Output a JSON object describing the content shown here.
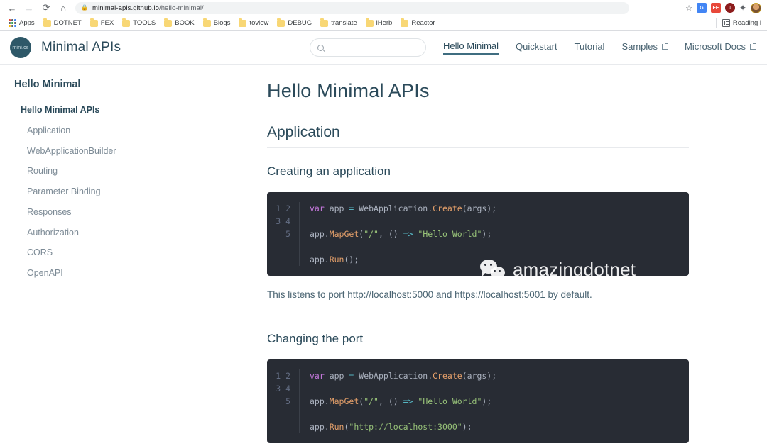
{
  "browser": {
    "back_icon": "←",
    "forward_icon": "→",
    "reload_icon": "⟳",
    "home_icon": "⌂",
    "lock_icon": "🔒",
    "url_domain": "minimal-apis.github.io",
    "url_path": "/hello-minimal/",
    "star_icon": "☆",
    "puzzle_icon": "🧩",
    "extensions": [
      {
        "name": "google-translate-extension",
        "label": "G"
      },
      {
        "name": "fe-extension",
        "label": "FE"
      },
      {
        "name": "ublock-extension",
        "label": "u"
      }
    ],
    "bookmarks": [
      {
        "label": "Apps",
        "icon": "apps-grid-icon"
      },
      {
        "label": "DOTNET",
        "icon": "folder-icon"
      },
      {
        "label": "FEX",
        "icon": "folder-icon"
      },
      {
        "label": "TOOLS",
        "icon": "folder-icon"
      },
      {
        "label": "BOOK",
        "icon": "folder-icon"
      },
      {
        "label": "Blogs",
        "icon": "folder-icon"
      },
      {
        "label": "toview",
        "icon": "folder-icon"
      },
      {
        "label": "DEBUG",
        "icon": "folder-icon"
      },
      {
        "label": "translate",
        "icon": "folder-icon"
      },
      {
        "label": "iHerb",
        "icon": "folder-icon"
      },
      {
        "label": "Reactor",
        "icon": "folder-icon"
      }
    ],
    "reading_list": "Reading l"
  },
  "site": {
    "logo_text": "mini.cs",
    "brand": "Minimal APIs",
    "search": {
      "value": "",
      "placeholder": ""
    },
    "nav": [
      {
        "label": "Hello Minimal",
        "active": true,
        "external": false
      },
      {
        "label": "Quickstart",
        "active": false,
        "external": false
      },
      {
        "label": "Tutorial",
        "active": false,
        "external": false
      },
      {
        "label": "Samples",
        "active": false,
        "external": true
      },
      {
        "label": "Microsoft Docs",
        "active": false,
        "external": true
      }
    ]
  },
  "sidebar": {
    "title": "Hello Minimal",
    "items": [
      {
        "label": "Hello Minimal APIs",
        "level": 1,
        "active": true
      },
      {
        "label": "Application",
        "level": 2,
        "active": false
      },
      {
        "label": "WebApplicationBuilder",
        "level": 2,
        "active": false
      },
      {
        "label": "Routing",
        "level": 2,
        "active": false
      },
      {
        "label": "Parameter Binding",
        "level": 2,
        "active": false
      },
      {
        "label": "Responses",
        "level": 2,
        "active": false
      },
      {
        "label": "Authorization",
        "level": 2,
        "active": false
      },
      {
        "label": "CORS",
        "level": 2,
        "active": false
      },
      {
        "label": "OpenAPI",
        "level": 2,
        "active": false
      }
    ]
  },
  "main": {
    "page_title": "Hello Minimal APIs",
    "section_heading": "Application",
    "subsection_1": "Creating an application",
    "code_1": {
      "line_numbers": "1\n2\n3\n4\n5",
      "lines": [
        "var app = WebApplication.Create(args);",
        "",
        "app.MapGet(\"/\", () => \"Hello World\");",
        "",
        "app.Run();"
      ]
    },
    "paragraph_1": "This listens to port http://localhost:5000 and https://localhost:5001 by default.",
    "subsection_2": "Changing the port",
    "code_2": {
      "line_numbers": "1\n2\n3\n4\n5",
      "lines": [
        "var app = WebApplication.Create(args);",
        "",
        "app.MapGet(\"/\", () => \"Hello World\");",
        "",
        "app.Run(\"http://localhost:3000\");"
      ]
    },
    "watermark_text": "amazingdotnet"
  },
  "colors": {
    "brand_teal": "#2b4a5a",
    "accent_teal": "#3f6d80",
    "code_bg": "#282c34",
    "keyword": "#c678dd",
    "function": "#e5a06a",
    "string": "#98c379",
    "plain": "#abb2bf",
    "muted_text": "#7d8b96"
  }
}
